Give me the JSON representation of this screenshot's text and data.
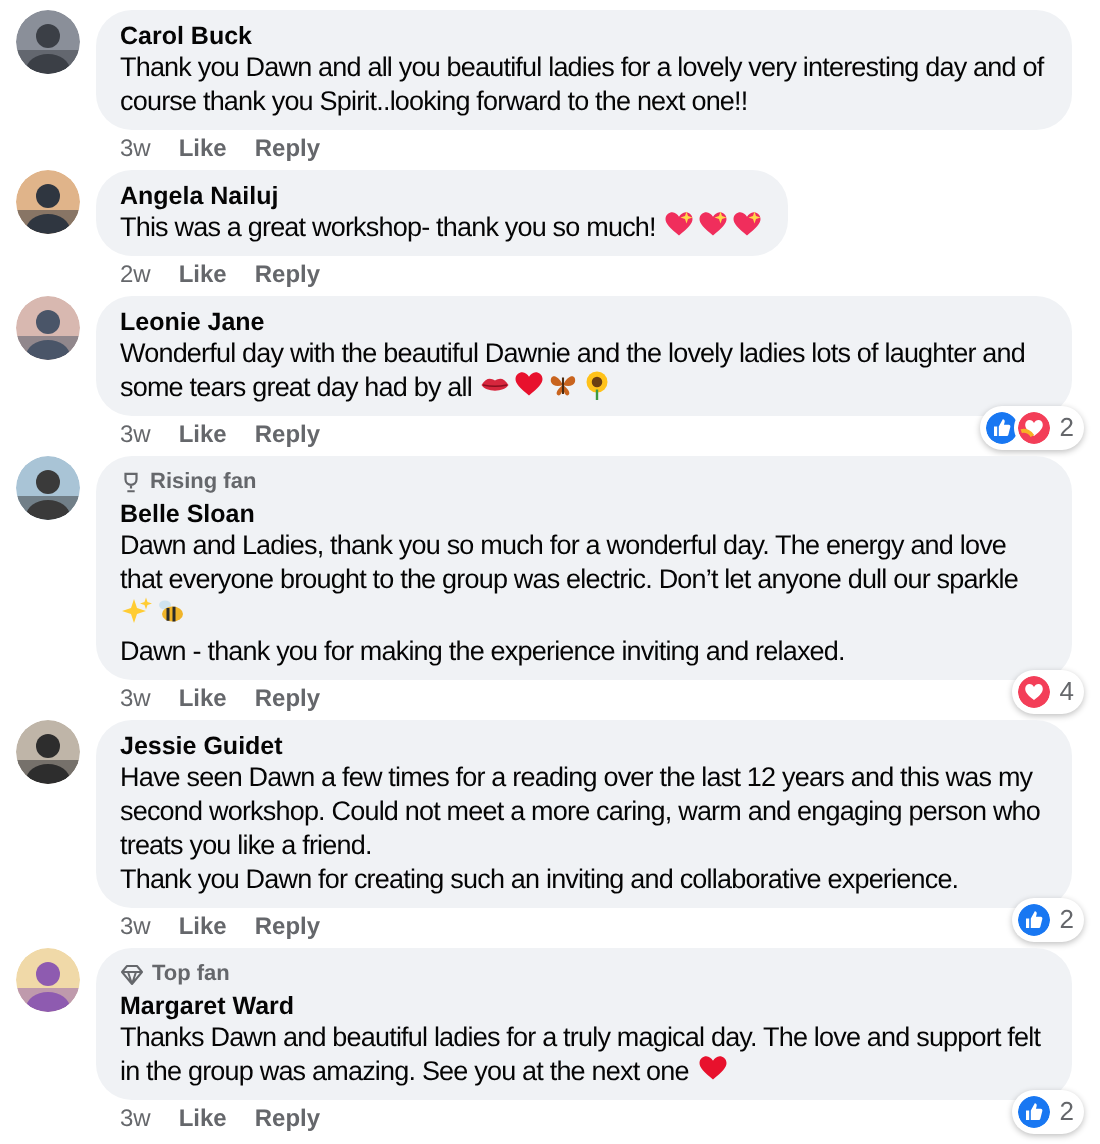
{
  "comments": [
    {
      "author": "Carol Buck",
      "paragraphs": [
        {
          "text": "Thank you Dawn and all you beautiful ladies for a lovely very interesting day and of course thank you Spirit..looking forward to the next one!!"
        }
      ],
      "time": "3w",
      "like": "Like",
      "reply": "Reply"
    },
    {
      "author": "Angela Nailuj",
      "paragraphs": [
        {
          "text": "This was a great workshop- thank you so much!",
          "emojis": [
            {
              "kind": "sparkling_heart"
            },
            {
              "kind": "sparkling_heart"
            },
            {
              "kind": "sparkling_heart"
            }
          ]
        }
      ],
      "time": "2w",
      "like": "Like",
      "reply": "Reply"
    },
    {
      "author": "Leonie Jane",
      "paragraphs": [
        {
          "text": "Wonderful day with the beautiful Dawnie and the lovely ladies lots of laughter and some tears great day had by all",
          "emojis": [
            {
              "kind": "kiss"
            },
            {
              "kind": "heart"
            },
            {
              "kind": "butterfly"
            },
            {
              "kind": "sunflower"
            }
          ]
        }
      ],
      "time": "3w",
      "like": "Like",
      "reply": "Reply",
      "reactions": {
        "kinds": [
          {
            "kind": "like"
          },
          {
            "kind": "care"
          }
        ],
        "count": "2"
      }
    },
    {
      "badge": {
        "kind": "rising",
        "label": "Rising fan"
      },
      "author": "Belle Sloan",
      "paragraphs": [
        {
          "text": "Dawn and Ladies, thank you so much for a wonderful day. The energy and love that everyone brought to the group was electric. Don’t let anyone dull our sparkle",
          "emojis": [
            {
              "kind": "sparkles"
            },
            {
              "kind": "bee"
            }
          ]
        },
        {
          "text": "Dawn - thank you for making the experience inviting and relaxed."
        }
      ],
      "time": "3w",
      "like": "Like",
      "reply": "Reply",
      "reactions": {
        "kinds": [
          {
            "kind": "love"
          }
        ],
        "count": "4"
      }
    },
    {
      "author": "Jessie Guidet",
      "paragraphs": [
        {
          "text": "Have seen Dawn a few times for a reading over the last 12 years and this was my second workshop. Could not meet a more caring, warm and engaging person who treats you like a friend.\nThank you Dawn for creating such an inviting and collaborative experience."
        }
      ],
      "time": "3w",
      "like": "Like",
      "reply": "Reply",
      "reactions": {
        "kinds": [
          {
            "kind": "like"
          }
        ],
        "count": "2"
      }
    },
    {
      "badge": {
        "kind": "top",
        "label": "Top fan"
      },
      "author": "Margaret Ward",
      "paragraphs": [
        {
          "text": "Thanks Dawn and beautiful ladies for a truly magical day. The love and support felt in the group was amazing. See you at the next one",
          "emojis": [
            {
              "kind": "heart"
            }
          ]
        }
      ],
      "time": "3w",
      "like": "Like",
      "reply": "Reply",
      "reactions": {
        "kinds": [
          {
            "kind": "like"
          }
        ],
        "count": "2"
      }
    }
  ]
}
